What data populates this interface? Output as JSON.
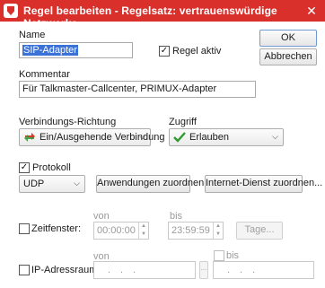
{
  "window": {
    "title": "Regel bearbeiten - Regelsatz: vertrauenswürdige Netzwerke",
    "accent": "#d9302c"
  },
  "name": {
    "label": "Name",
    "value": "SIP-Adapter"
  },
  "regel_aktiv": {
    "label": "Regel aktiv",
    "checked": true
  },
  "buttons": {
    "ok": "OK",
    "abbrechen": "Abbrechen"
  },
  "kommentar": {
    "label": "Kommentar",
    "value": "Für Talkmaster-Callcenter, PRIMUX-Adapter"
  },
  "verbindung": {
    "label": "Verbindungs-Richtung",
    "value": "Ein/Ausgehende Verbindung",
    "icon": "bidirectional-arrows-icon"
  },
  "zugriff": {
    "label": "Zugriff",
    "value": "Erlauben",
    "icon": "green-checkmark-icon"
  },
  "protokoll": {
    "label": "Protokoll",
    "checked": true,
    "value": "UDP"
  },
  "anwendungen_button": "Anwendungen zuordnen...",
  "internet_dienst_button": "Internet-Dienst  zuordnen...",
  "zeitfenster": {
    "label": "Zeitfenster:",
    "checked": false,
    "von_label": "von",
    "bis_label": "bis",
    "von_value": "00:00:00",
    "bis_value": "23:59:59",
    "tage_button": "Tage..."
  },
  "ip": {
    "label": "IP-Adressraum:",
    "checked": false,
    "von_label": "von",
    "bis_label": "bis",
    "bis_checked": false,
    "separator": "...",
    "dots": "...",
    "ellipsis_button": "..."
  }
}
